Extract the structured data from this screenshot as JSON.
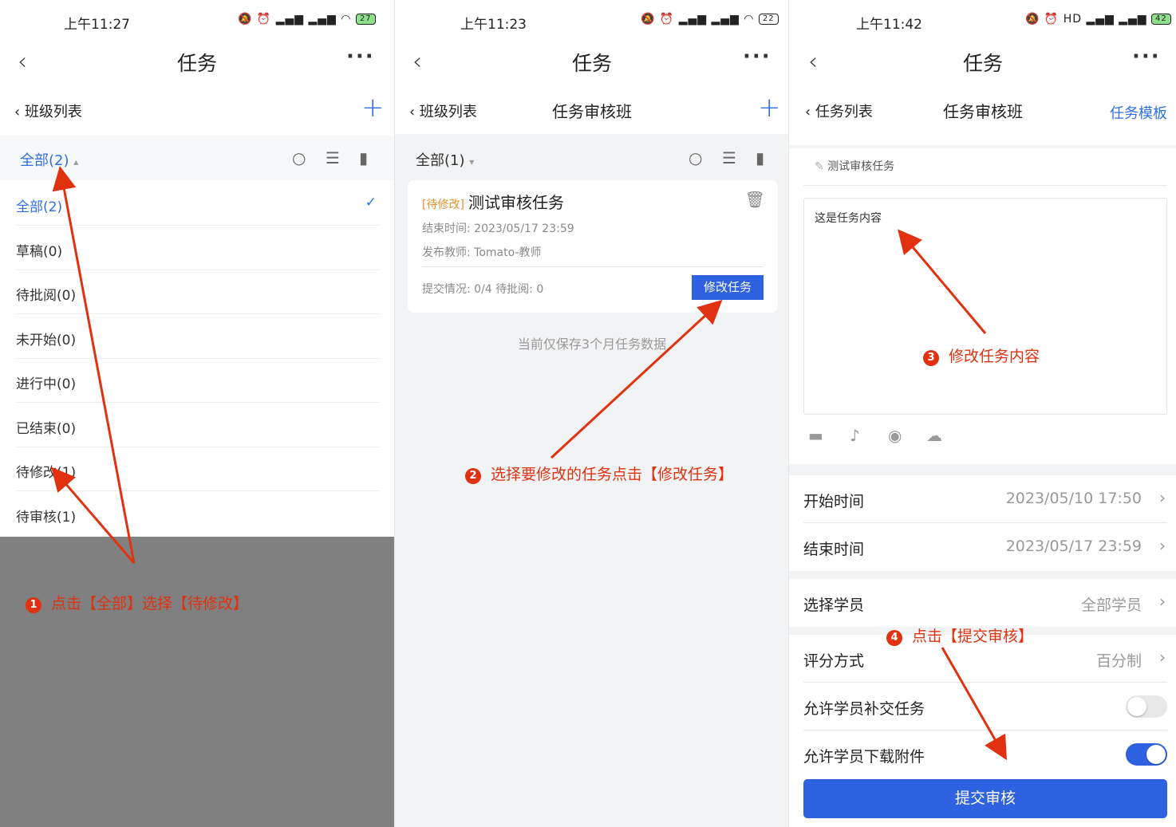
{
  "colors": {
    "accent": "#2f6fe3",
    "annotation": "#e03210",
    "overlay": "#808080",
    "tag": "#e8902c"
  },
  "panel1": {
    "status": {
      "time": "上午11:27",
      "battery": "27"
    },
    "nav": {
      "back": "‹",
      "title": "任务",
      "more": "···"
    },
    "sub": {
      "back": "‹ 班级列表",
      "add": "+"
    },
    "filter": {
      "label": "全部(2)",
      "caret": "▴"
    },
    "menu": [
      {
        "label": "全部(2)",
        "selected": true
      },
      {
        "label": "草稿(0)"
      },
      {
        "label": "待批阅(0)"
      },
      {
        "label": "未开始(0)"
      },
      {
        "label": "进行中(0)"
      },
      {
        "label": "已结束(0)"
      },
      {
        "label": "待修改(1)"
      },
      {
        "label": "待审核(1)"
      }
    ],
    "check": "✓",
    "note": {
      "num": "1",
      "text": "点击【全部】选择【待修改】"
    }
  },
  "panel2": {
    "status": {
      "time": "上午11:23",
      "battery": "22"
    },
    "nav": {
      "back": "‹",
      "title": "任务",
      "more": "···"
    },
    "sub": {
      "back": "‹ 班级列表",
      "title": "任务审核班",
      "add": "+"
    },
    "filter": {
      "label": "全部(1)",
      "caret": "▾"
    },
    "card": {
      "tag": "[待修改]",
      "title": "测试审核任务",
      "end_time": "结束时间: 2023/05/17 23:59",
      "teacher": "发布教师: Tomato-教师",
      "submission": "提交情况: 0/4 待批阅: 0",
      "edit_button": "修改任务"
    },
    "footnote": "当前仅保存3个月任务数据",
    "note": {
      "num": "2",
      "text": "选择要修改的任务点击【修改任务】"
    }
  },
  "panel3": {
    "status": {
      "time": "上午11:42",
      "battery": "42"
    },
    "nav": {
      "back": "‹",
      "title": "任务",
      "more": "···"
    },
    "sub": {
      "back": "‹ 任务列表",
      "title": "任务审核班",
      "template": "任务模板"
    },
    "task_name": "测试审核任务",
    "content": "这是任务内容",
    "rows": {
      "start": {
        "label": "开始时间",
        "value": "2023/05/10 17:50"
      },
      "end": {
        "label": "结束时间",
        "value": "2023/05/17 23:59"
      },
      "students": {
        "label": "选择学员",
        "value": "全部学员"
      },
      "grading": {
        "label": "评分方式",
        "value": "百分制"
      },
      "late": {
        "label": "允许学员补交任务",
        "on": false
      },
      "download": {
        "label": "允许学员下载附件",
        "on": true
      }
    },
    "chev": "›",
    "submit": "提交审核",
    "note3": {
      "num": "3",
      "text": "修改任务内容"
    },
    "note4": {
      "num": "4",
      "text": "点击【提交审核】"
    }
  }
}
